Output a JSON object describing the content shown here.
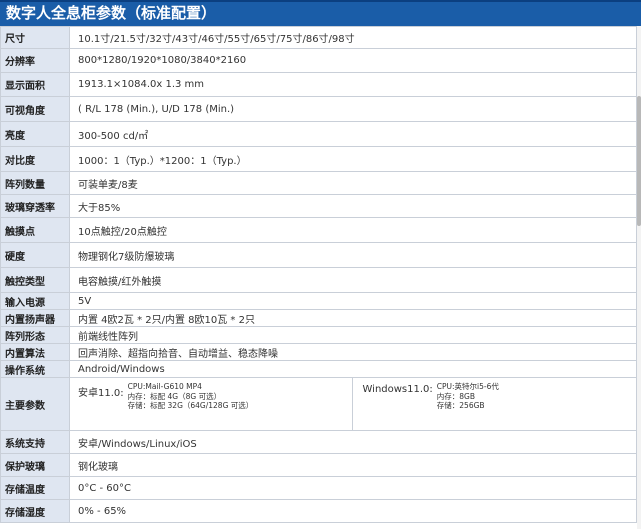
{
  "title": "数字人全息柜参数（标准配置）",
  "rows": [
    {
      "label": "尺寸",
      "value": "10.1寸/21.5寸/32寸/43寸/46寸/55寸/65寸/75寸/86寸/98寸"
    },
    {
      "label": "分辨率",
      "value": "800*1280/1920*1080/3840*2160"
    },
    {
      "label": "显示面积",
      "value": "1913.1×1084.0x 1.3 mm"
    },
    {
      "label": "可视角度",
      "value": "( R/L 178 (Min.), U/D 178 (Min.)"
    },
    {
      "label": "亮度",
      "value": "300-500 cd/㎡"
    },
    {
      "label": "对比度",
      "value": "1000：1（Typ.）*1200：1（Typ.）"
    },
    {
      "label": "阵列数量",
      "value": "可装单麦/8麦"
    },
    {
      "label": "玻璃穿透率",
      "value": "大于85%"
    },
    {
      "label": "触摸点",
      "value": "10点触控/20点触控"
    },
    {
      "label": "硬度",
      "value": "物理钢化7级防爆玻璃"
    },
    {
      "label": "触控类型",
      "value": "电容触摸/红外触摸"
    },
    {
      "label": "输入电源",
      "value": "5V"
    },
    {
      "label": "内置扬声器",
      "value": "内置 4欧2瓦 * 2只/内置 8欧10瓦 * 2只"
    },
    {
      "label": "阵列形态",
      "value": "前端线性阵列"
    },
    {
      "label": "内置算法",
      "value": "回声消除、超指向拾音、自动增益、稳态降噪"
    },
    {
      "label": "操作系统",
      "value": "Android/Windows"
    }
  ],
  "main_params": {
    "label": "主要参数",
    "android": {
      "os": "安卓11.0:",
      "lines": [
        "CPU:Mail-G610 MP4",
        "内存：标配 4G（8G 可选）",
        "存储：标配 32G（64G/128G 可选）"
      ]
    },
    "windows": {
      "os": "Windows11.0:",
      "lines": [
        "CPU:英特尔i5-6代",
        "内存：8GB",
        "存储：256GB"
      ]
    }
  },
  "rows_after": [
    {
      "label": "系统支持",
      "value": "安卓/Windows/Linux/iOS"
    },
    {
      "label": "保护玻璃",
      "value": "钢化玻璃"
    },
    {
      "label": "存储温度",
      "value": "0°C - 60°C"
    },
    {
      "label": "存储湿度",
      "value": "0% - 65%"
    }
  ]
}
